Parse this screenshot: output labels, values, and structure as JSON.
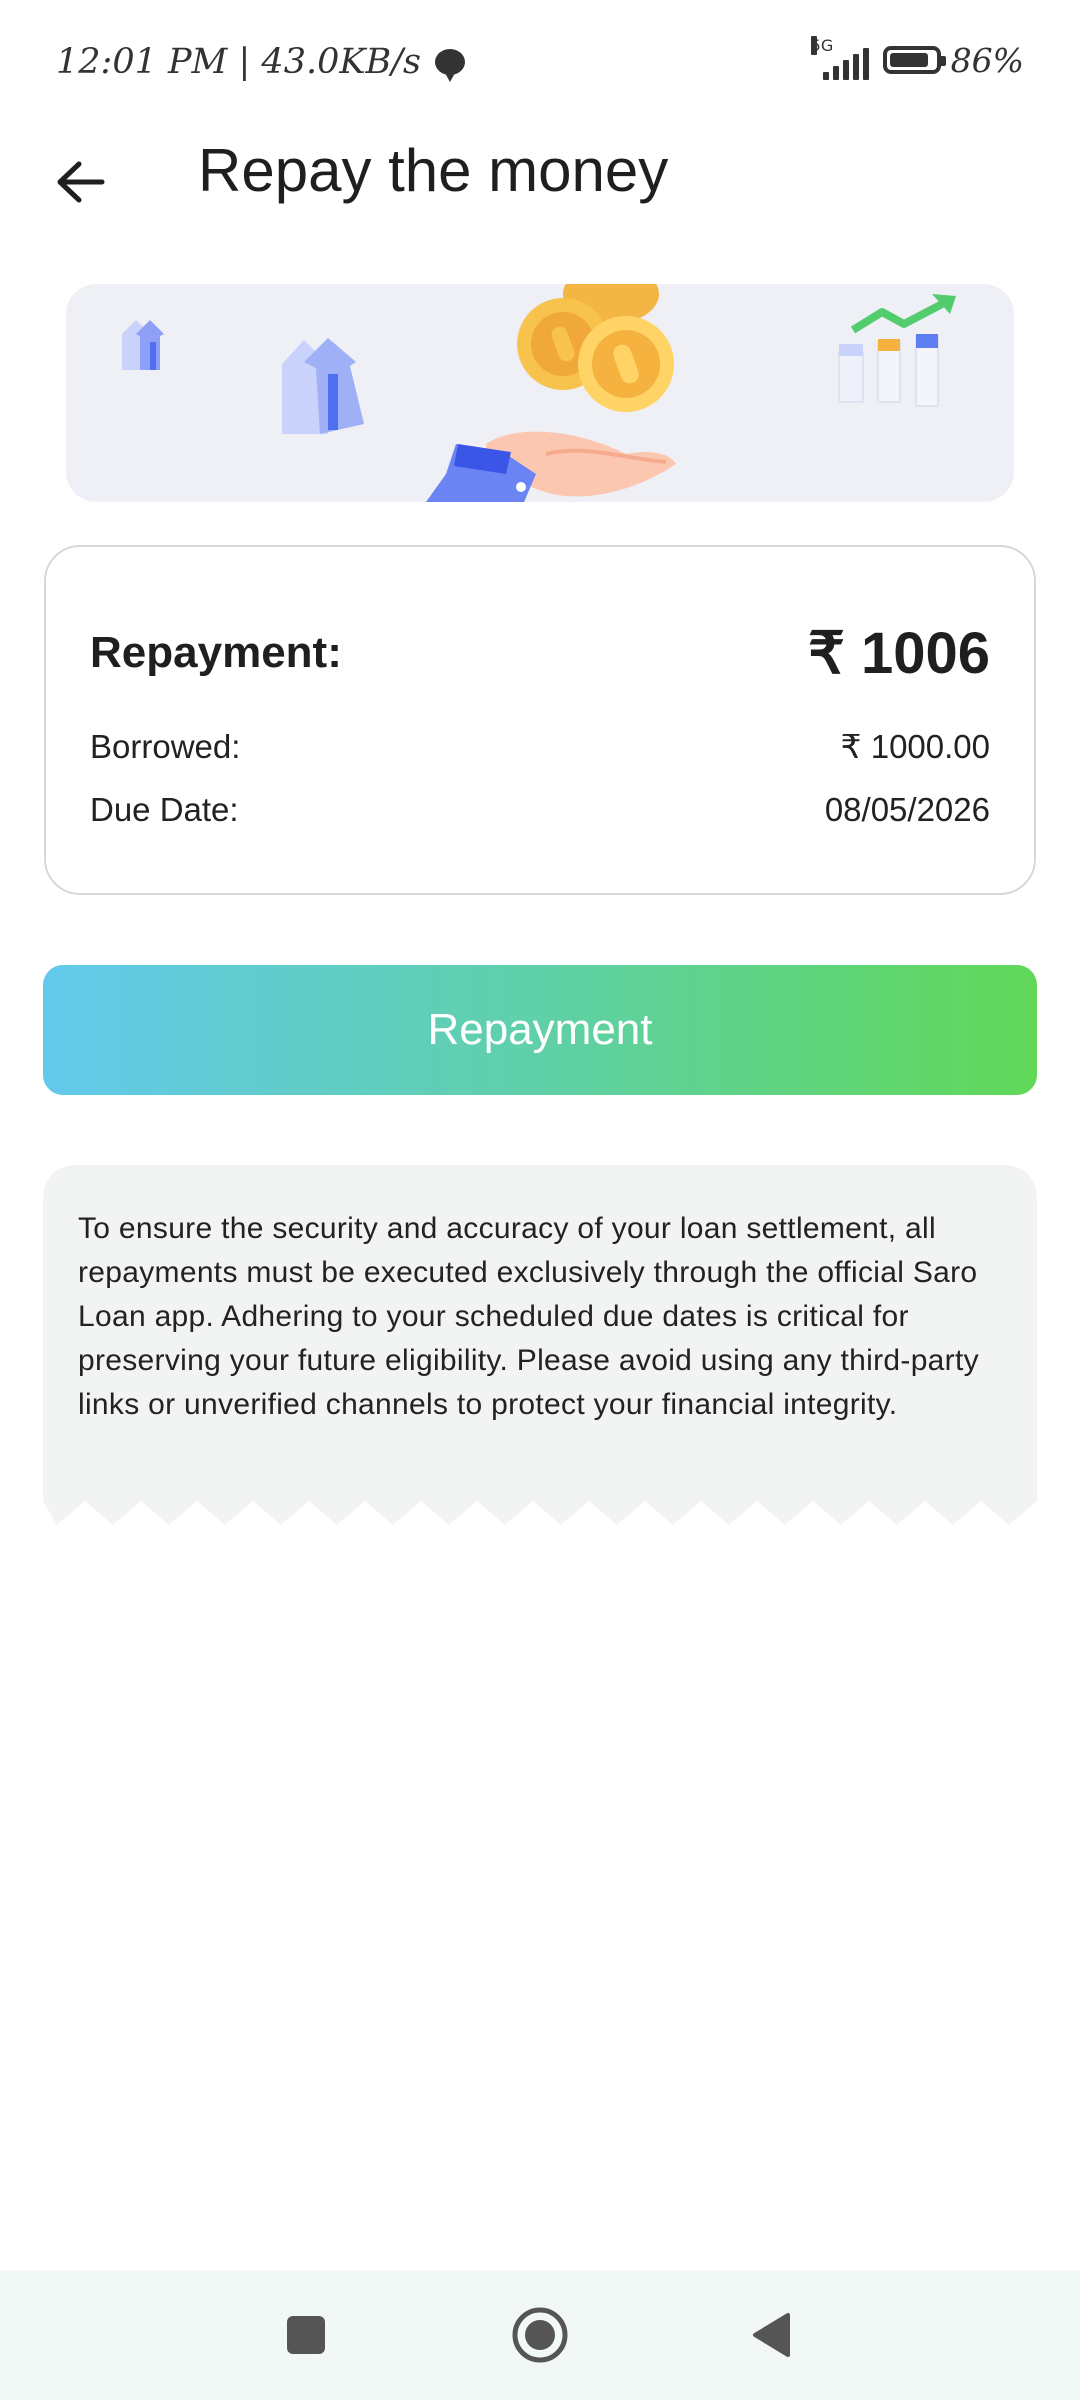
{
  "status_bar": {
    "time_and_speed": "12:01 PM | 43.0KB/s",
    "network_label": "5G",
    "battery_percent": "86%",
    "battery_level": 0.86
  },
  "header": {
    "title": "Repay the money"
  },
  "repayment_card": {
    "repayment_label": "Repayment:",
    "repayment_amount": "₹ 1006",
    "borrowed_label": "Borrowed:",
    "borrowed_amount": "₹ 1000.00",
    "due_date_label": "Due Date:",
    "due_date": "08/05/2026"
  },
  "repay_button": {
    "label": "Repayment"
  },
  "notice": {
    "text": "To ensure the security and accuracy of your loan settlement, all repayments must be executed exclusively through the official Saro Loan app. Adhering to your scheduled due dates is critical for preserving your future eligibility. Please avoid using any third-party links or unverified channels to protect your financial integrity."
  },
  "colors": {
    "button_gradient_start": "#63c9ec",
    "button_gradient_end": "#61d858",
    "notice_background": "#f2f3f3",
    "banner_background": "#eef0f5"
  },
  "nav": {
    "icons": [
      "recents-icon",
      "home-icon",
      "back-icon"
    ]
  }
}
